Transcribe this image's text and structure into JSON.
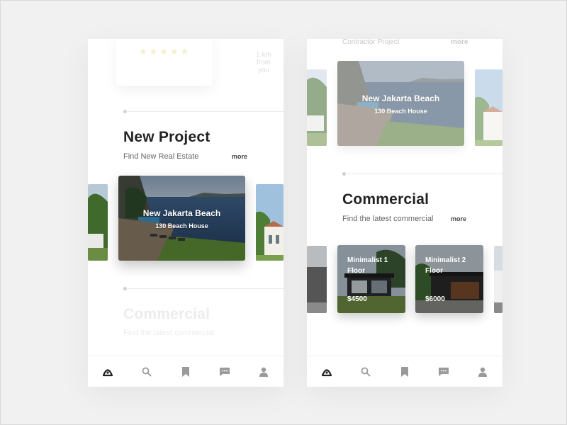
{
  "left": {
    "review": {
      "stars": "★★★★★",
      "distance": "1 km from you"
    },
    "new_project": {
      "title": "New Project",
      "subtitle": "Find New Real Estate",
      "more": "more",
      "card": {
        "title": "New Jakarta Beach",
        "subtitle": "130 Beach House"
      }
    },
    "commercial": {
      "title": "Commercial",
      "subtitle": "Find the latest commercial"
    }
  },
  "right": {
    "contractor": {
      "title": "Contractor Project",
      "more": "more"
    },
    "featured_card": {
      "title": "New Jakarta Beach",
      "subtitle": "130 Beach House"
    },
    "commercial": {
      "title": "Commercial",
      "subtitle": "Find the latest commercial",
      "more": "more",
      "items": [
        {
          "title": "Minimalist 1 Floor",
          "price": "$4500"
        },
        {
          "title": "Minimalist 2 Floor",
          "price": "$6000"
        }
      ]
    }
  },
  "tabbar": {
    "icons": [
      "home-icon",
      "search-icon",
      "bookmark-icon",
      "chat-icon",
      "profile-icon"
    ]
  },
  "colors": {
    "background": "#f1f1f1",
    "title": "#222222",
    "sea": "#2f4f78",
    "grass": "#5f8a3a"
  }
}
